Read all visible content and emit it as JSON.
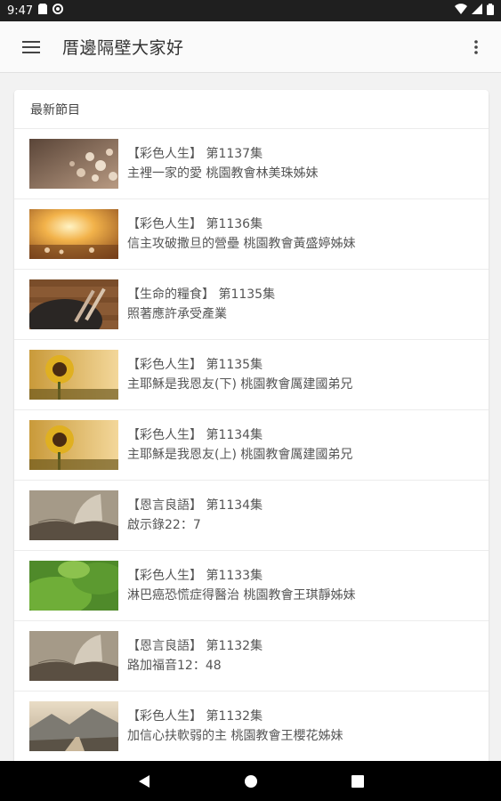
{
  "status_bar": {
    "time": "9:47",
    "icons": [
      "sd-card-icon",
      "sync-icon",
      "wifi-icon",
      "signal-icon",
      "battery-icon"
    ]
  },
  "app_bar": {
    "title": "厝邊隔壁大家好",
    "menu_icon": "hamburger-menu-icon",
    "more_icon": "more-vert-icon"
  },
  "list": {
    "header": "最新節目",
    "items": [
      {
        "title": "【彩色人生】 第1137集",
        "subtitle": "主裡一家的愛 桃園教會林美珠姊妹",
        "thumb": "hearts-bokeh"
      },
      {
        "title": "【彩色人生】 第1136集",
        "subtitle": "信主攻破撒旦的營壘 桃園教會黃盛婷姊妹",
        "thumb": "sunset-field"
      },
      {
        "title": "【生命的糧食】 第1135集",
        "subtitle": "照著應許承受產業",
        "thumb": "plate-fork"
      },
      {
        "title": "【彩色人生】 第1135集",
        "subtitle": "主耶穌是我恩友(下) 桃園教會厲建國弟兄",
        "thumb": "sunflower"
      },
      {
        "title": "【彩色人生】 第1134集",
        "subtitle": "主耶穌是我恩友(上) 桃園教會厲建國弟兄",
        "thumb": "sunflower"
      },
      {
        "title": "【恩言良語】 第1134集",
        "subtitle": "啟示錄22：7",
        "thumb": "open-book"
      },
      {
        "title": "【彩色人生】 第1133集",
        "subtitle": "淋巴癌恐慌症得醫治 桃園教會王琪靜姊妹",
        "thumb": "green-leaves"
      },
      {
        "title": "【恩言良語】 第1132集",
        "subtitle": "路加福音12：48",
        "thumb": "open-book"
      },
      {
        "title": "【彩色人生】 第1132集",
        "subtitle": "加信心扶軟弱的主 桃園教會王櫻花姊妹",
        "thumb": "mountain-road"
      }
    ]
  },
  "nav_bar": {
    "icons": [
      "back-icon",
      "home-icon",
      "recents-icon"
    ]
  },
  "colors": {
    "status_bar": "#1f1f1f",
    "app_bar": "#fafafa",
    "background": "#f2f2f2",
    "text": "#555555"
  }
}
